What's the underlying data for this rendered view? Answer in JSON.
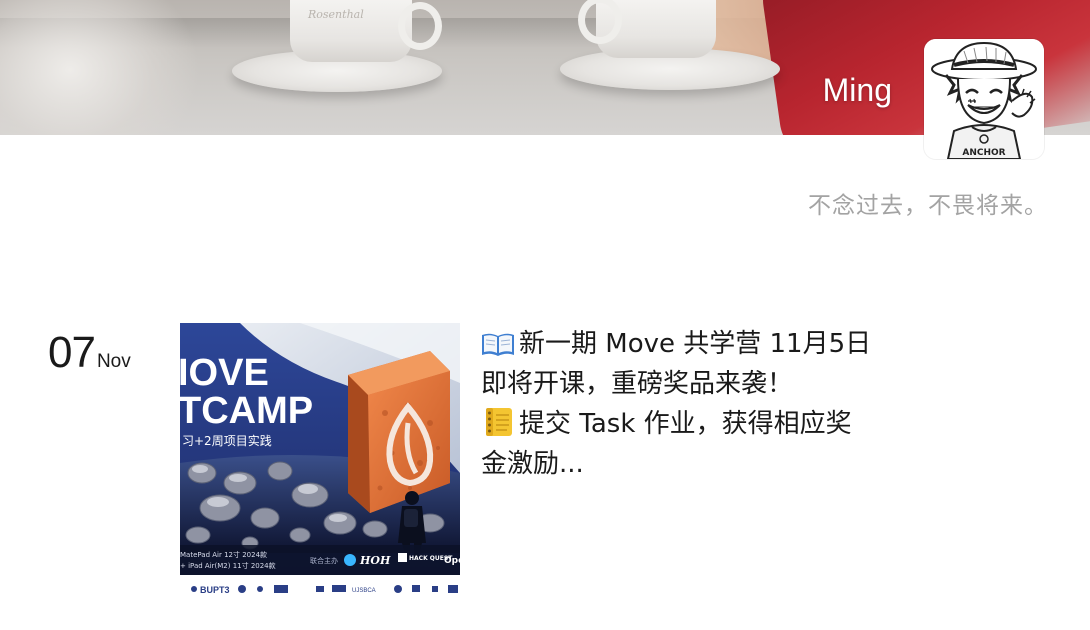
{
  "profile": {
    "username": "Ming",
    "signature": "不念过去，不畏将来。",
    "avatar_icon": "luffy-avatar-icon"
  },
  "cover": {
    "cup_brand_text": "Rosenthal"
  },
  "feed": {
    "items": [
      {
        "date": {
          "day": "07",
          "month": "Nov"
        },
        "thumbnail": {
          "title_line1": "IOVE",
          "title_line2": "TCAMP",
          "subtitle": "习+2周项目实践",
          "prize_line1": "MatePad Air 12寸 2024款",
          "prize_line2": "+ iPad Air(M2) 11寸 2024款",
          "cohost_label": "联合主办",
          "hoh_logo_text": "HOH",
          "hackquest_logo_text": "HACK QUEST",
          "partner_truncated": "Ope",
          "bupt_logo_text": "BUPT3",
          "uvsbca_logo_text": "UJSBCA"
        },
        "text_lines": [
          "新一期 Move 共学营 11月5日",
          "即将开课，重磅奖品来袭！",
          "提交 Task 作业，获得相应奖",
          "金激励..."
        ],
        "line_icons": [
          "open-book-icon",
          "",
          "notebook-icon",
          ""
        ]
      }
    ]
  },
  "colors": {
    "signature_gray": "#a3a3a3",
    "text_dark": "#1a1a1a",
    "thumb_blue": "#2a3e86",
    "cube_orange": "#e87a3a"
  }
}
